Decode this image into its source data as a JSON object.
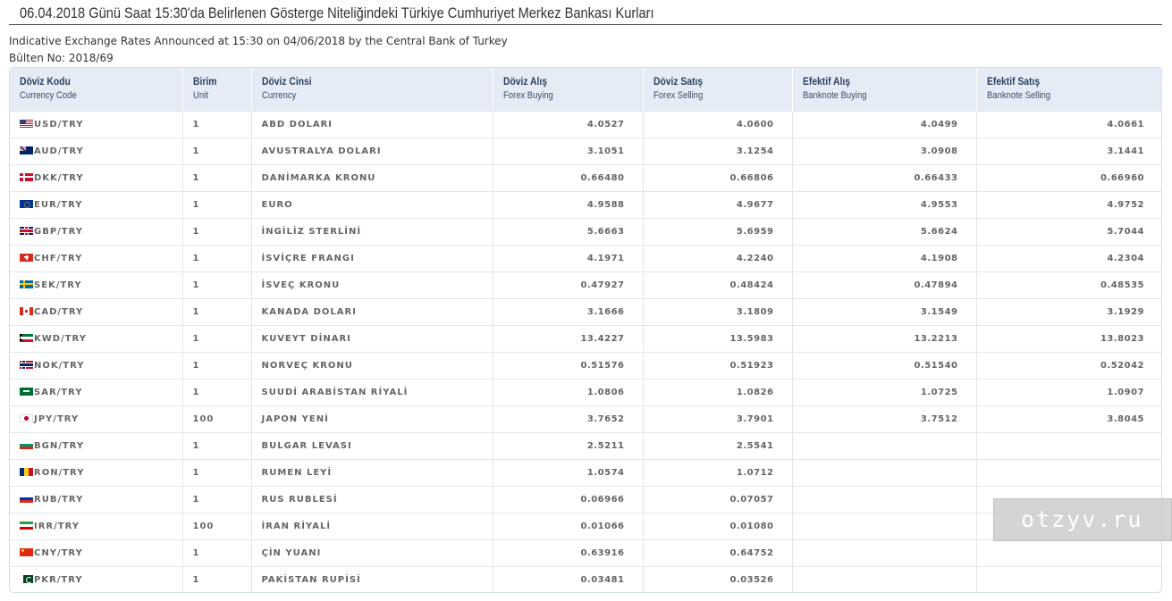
{
  "header": {
    "title": "06.04.2018 Günü Saat 15:30'da Belirlenen Gösterge Niteliğindeki Türkiye Cumhuriyet Merkez Bankası Kurları",
    "subtitle": "Indicative Exchange Rates Announced at 15:30 on 04/06/2018 by the Central Bank of Turkey",
    "bulletin": "Bülten No: 2018/69"
  },
  "table": {
    "columns": [
      {
        "tr": "Döviz Kodu",
        "en": "Currency Code"
      },
      {
        "tr": "Birim",
        "en": "Unit"
      },
      {
        "tr": "Döviz Cinsi",
        "en": "Currency"
      },
      {
        "tr": "Döviz Alış",
        "en": "Forex Buying"
      },
      {
        "tr": "Döviz Satış",
        "en": "Forex Selling"
      },
      {
        "tr": "Efektif Alış",
        "en": "Banknote Buying"
      },
      {
        "tr": "Efektif Satış",
        "en": "Banknote Selling"
      }
    ],
    "rows": [
      {
        "flag": "usd",
        "code": "USD/TRY",
        "unit": "1",
        "name": "ABD DOLARI",
        "forex_buying": "4.0527",
        "forex_selling": "4.0600",
        "banknote_buying": "4.0499",
        "banknote_selling": "4.0661"
      },
      {
        "flag": "aud",
        "code": "AUD/TRY",
        "unit": "1",
        "name": "AVUSTRALYA DOLARI",
        "forex_buying": "3.1051",
        "forex_selling": "3.1254",
        "banknote_buying": "3.0908",
        "banknote_selling": "3.1441"
      },
      {
        "flag": "dkk",
        "code": "DKK/TRY",
        "unit": "1",
        "name": "DANİMARKA KRONU",
        "forex_buying": "0.66480",
        "forex_selling": "0.66806",
        "banknote_buying": "0.66433",
        "banknote_selling": "0.66960"
      },
      {
        "flag": "eur",
        "code": "EUR/TRY",
        "unit": "1",
        "name": "EURO",
        "forex_buying": "4.9588",
        "forex_selling": "4.9677",
        "banknote_buying": "4.9553",
        "banknote_selling": "4.9752"
      },
      {
        "flag": "gbp",
        "code": "GBP/TRY",
        "unit": "1",
        "name": "İNGİLİZ STERLİNİ",
        "forex_buying": "5.6663",
        "forex_selling": "5.6959",
        "banknote_buying": "5.6624",
        "banknote_selling": "5.7044"
      },
      {
        "flag": "chf",
        "code": "CHF/TRY",
        "unit": "1",
        "name": "İSVİÇRE FRANGI",
        "forex_buying": "4.1971",
        "forex_selling": "4.2240",
        "banknote_buying": "4.1908",
        "banknote_selling": "4.2304"
      },
      {
        "flag": "sek",
        "code": "SEK/TRY",
        "unit": "1",
        "name": "İSVEÇ KRONU",
        "forex_buying": "0.47927",
        "forex_selling": "0.48424",
        "banknote_buying": "0.47894",
        "banknote_selling": "0.48535"
      },
      {
        "flag": "cad",
        "code": "CAD/TRY",
        "unit": "1",
        "name": "KANADA DOLARI",
        "forex_buying": "3.1666",
        "forex_selling": "3.1809",
        "banknote_buying": "3.1549",
        "banknote_selling": "3.1929"
      },
      {
        "flag": "kwd",
        "code": "KWD/TRY",
        "unit": "1",
        "name": "KUVEYT DİNARI",
        "forex_buying": "13.4227",
        "forex_selling": "13.5983",
        "banknote_buying": "13.2213",
        "banknote_selling": "13.8023"
      },
      {
        "flag": "nok",
        "code": "NOK/TRY",
        "unit": "1",
        "name": "NORVEÇ KRONU",
        "forex_buying": "0.51576",
        "forex_selling": "0.51923",
        "banknote_buying": "0.51540",
        "banknote_selling": "0.52042"
      },
      {
        "flag": "sar",
        "code": "SAR/TRY",
        "unit": "1",
        "name": "SUUDİ ARABİSTAN RİYALİ",
        "forex_buying": "1.0806",
        "forex_selling": "1.0826",
        "banknote_buying": "1.0725",
        "banknote_selling": "1.0907"
      },
      {
        "flag": "jpy",
        "code": "JPY/TRY",
        "unit": "100",
        "name": "JAPON YENİ",
        "forex_buying": "3.7652",
        "forex_selling": "3.7901",
        "banknote_buying": "3.7512",
        "banknote_selling": "3.8045"
      },
      {
        "flag": "bgn",
        "code": "BGN/TRY",
        "unit": "1",
        "name": "BULGAR LEVASI",
        "forex_buying": "2.5211",
        "forex_selling": "2.5541",
        "banknote_buying": "",
        "banknote_selling": ""
      },
      {
        "flag": "ron",
        "code": "RON/TRY",
        "unit": "1",
        "name": "RUMEN LEYİ",
        "forex_buying": "1.0574",
        "forex_selling": "1.0712",
        "banknote_buying": "",
        "banknote_selling": ""
      },
      {
        "flag": "rub",
        "code": "RUB/TRY",
        "unit": "1",
        "name": "RUS RUBLESİ",
        "forex_buying": "0.06966",
        "forex_selling": "0.07057",
        "banknote_buying": "",
        "banknote_selling": ""
      },
      {
        "flag": "irr",
        "code": "IRR/TRY",
        "unit": "100",
        "name": "İRAN RİYALİ",
        "forex_buying": "0.01066",
        "forex_selling": "0.01080",
        "banknote_buying": "",
        "banknote_selling": ""
      },
      {
        "flag": "cny",
        "code": "CNY/TRY",
        "unit": "1",
        "name": "ÇİN YUANI",
        "forex_buying": "0.63916",
        "forex_selling": "0.64752",
        "banknote_buying": "",
        "banknote_selling": ""
      },
      {
        "flag": "pkr",
        "code": "PKR/TRY",
        "unit": "1",
        "name": "PAKİSTAN RUPİSİ",
        "forex_buying": "0.03481",
        "forex_selling": "0.03526",
        "banknote_buying": "",
        "banknote_selling": ""
      }
    ]
  },
  "watermark": "otzyv.ru"
}
